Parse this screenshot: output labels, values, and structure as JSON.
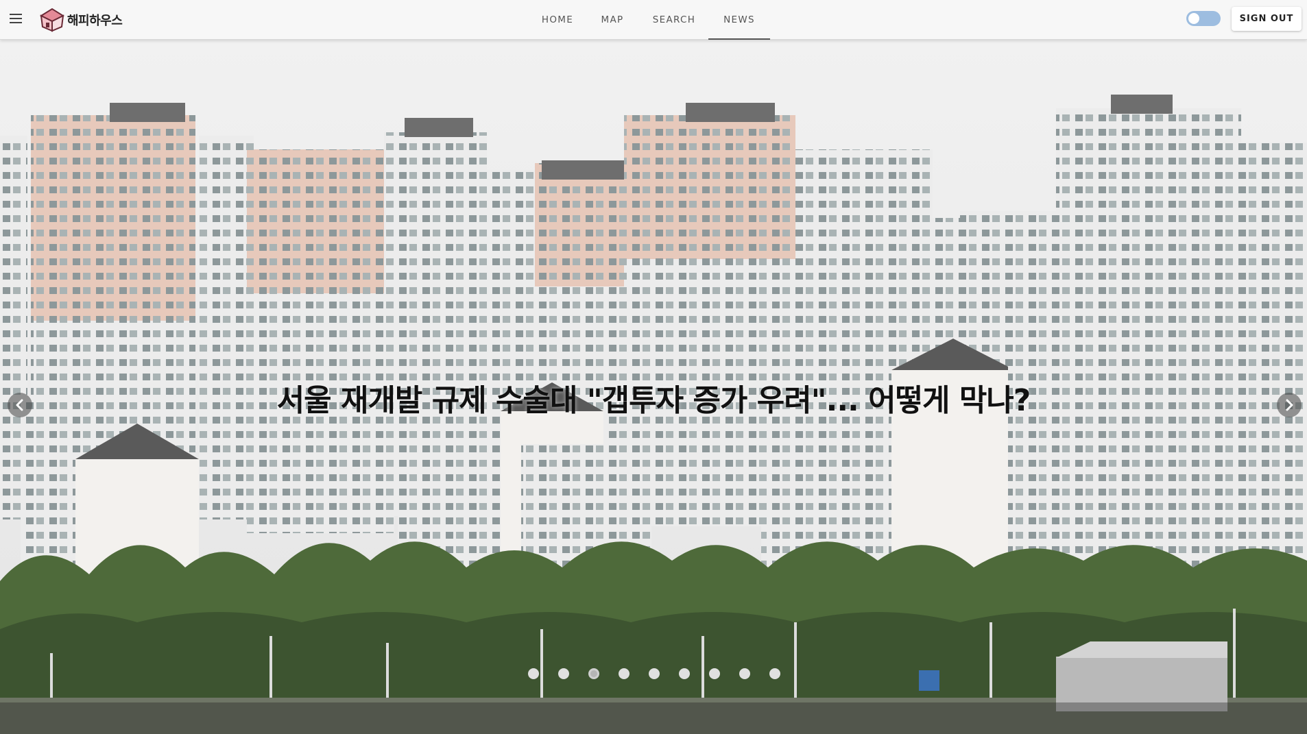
{
  "header": {
    "brand_name": "해피하우스",
    "nav": [
      {
        "label": "HOME"
      },
      {
        "label": "MAP"
      },
      {
        "label": "SEARCH"
      },
      {
        "label": "NEWS",
        "active": true
      }
    ],
    "theme_toggle": {
      "on": false
    },
    "signout_label": "SIGN OUT"
  },
  "carousel": {
    "headline": "서울 재개발 규제 수술대 \"갭투자 증가 우려\"... 어떻게 막나?",
    "slide_count": 9,
    "active_index": 2,
    "icons": {
      "prev": "chevron-left-icon",
      "next": "chevron-right-icon"
    }
  },
  "colors": {
    "topbar": "#f7f7f7",
    "toggle": "#9dbde0",
    "headline": "#111111"
  }
}
